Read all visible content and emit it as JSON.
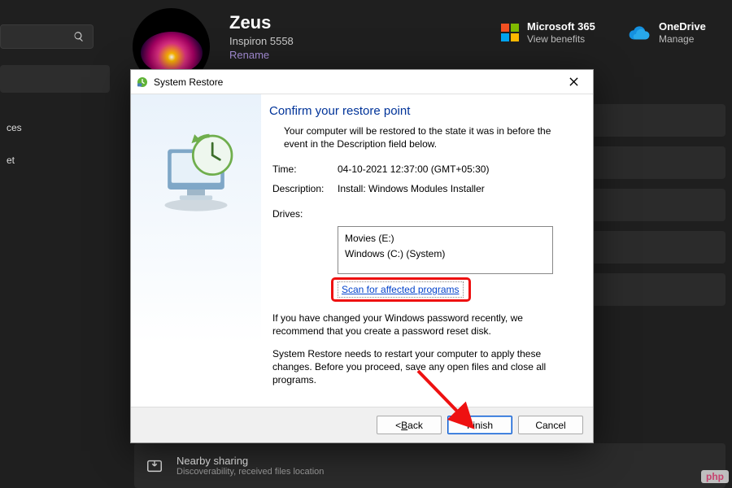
{
  "header": {
    "user_name": "Zeus",
    "device_model": "Inspiron 5558",
    "rename_link": "Rename",
    "ms365": {
      "title": "Microsoft 365",
      "sub": "View benefits"
    },
    "onedrive": {
      "title": "OneDrive",
      "sub": "Manage"
    }
  },
  "sidebar": {
    "item_ces": "ces",
    "item_et": "et"
  },
  "nearby": {
    "title": "Nearby sharing",
    "sub": "Discoverability, received files location"
  },
  "dialog": {
    "title": "System Restore",
    "heading": "Confirm your restore point",
    "intro": "Your computer will be restored to the state it was in before the event in the Description field below.",
    "time_label": "Time:",
    "time_value": "04-10-2021 12:37:00 (GMT+05:30)",
    "desc_label": "Description:",
    "desc_value": "Install: Windows Modules Installer",
    "drives_label": "Drives:",
    "drive1": "Movies (E:)",
    "drive2": "Windows (C:) (System)",
    "scan_link": "Scan for affected programs",
    "para1": "If you have changed your Windows password recently, we recommend that you create a password reset disk.",
    "para2": "System Restore needs to restart your computer to apply these changes. Before you proceed, save any open files and close all programs.",
    "btn_back_pre": "< ",
    "btn_back_ul": "B",
    "btn_back_post": "ack",
    "btn_finish": "Finish",
    "btn_cancel": "Cancel"
  },
  "watermark": "php"
}
